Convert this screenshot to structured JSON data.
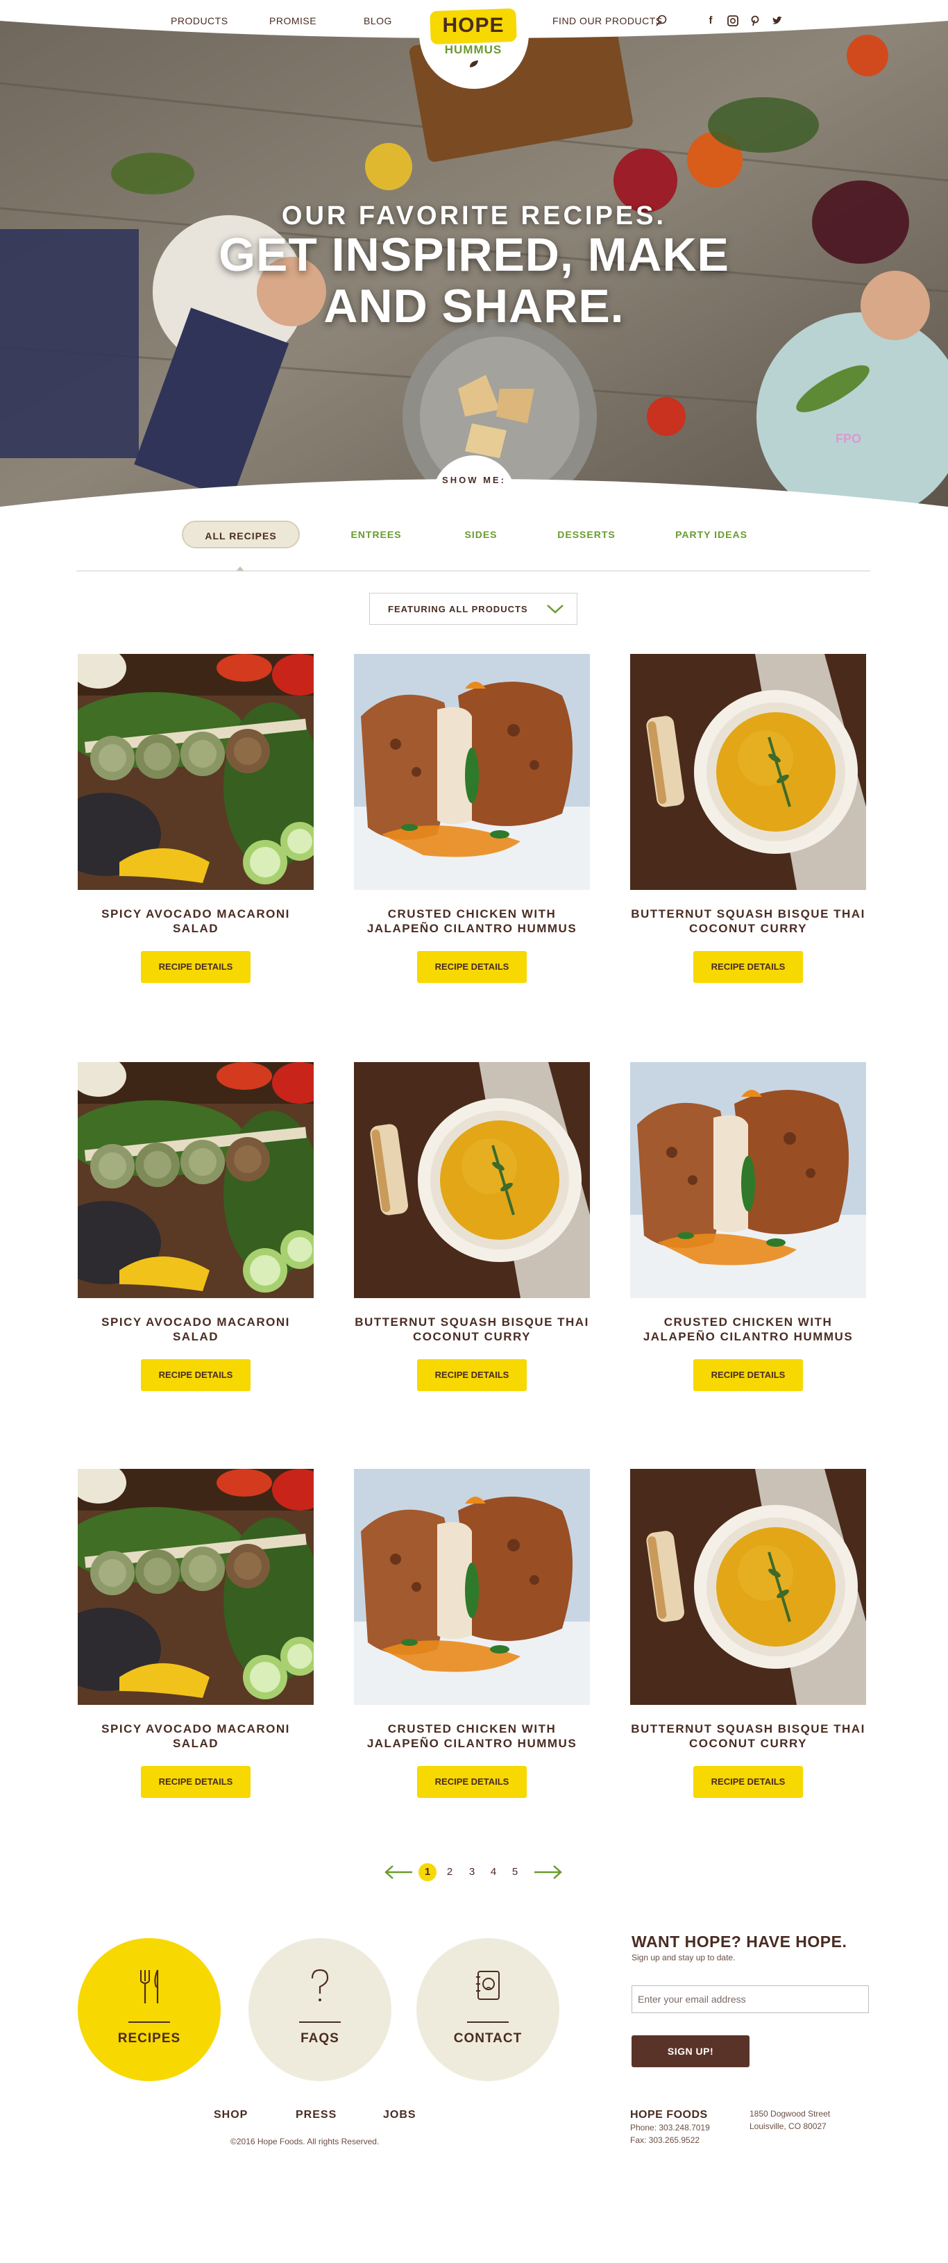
{
  "nav": {
    "products": "PRODUCTS",
    "promise": "PROMISE",
    "blog": "BLOG",
    "find": "FIND OUR PRODUCTS"
  },
  "logo": {
    "brand": "HOPE",
    "sub": "HUMMUS"
  },
  "hero": {
    "kicker": "OUR FAVORITE RECIPES.",
    "title": "GET INSPIRED, MAKE AND SHARE.",
    "fpo": "FPO",
    "show_me": "SHOW ME:"
  },
  "filters": [
    "ALL RECIPES",
    "ENTREES",
    "SIDES",
    "DESSERTS",
    "PARTY IDEAS"
  ],
  "dropdown": {
    "label": "FEATURING ALL PRODUCTS"
  },
  "button_label": "RECIPE DETAILS",
  "recipes": [
    {
      "title": "SPICY AVOCADO MACARONI SALAD",
      "photo": "skewers"
    },
    {
      "title": "CRUSTED CHICKEN WITH JALAPEÑO CILANTRO HUMMUS",
      "photo": "chicken"
    },
    {
      "title": "BUTTERNUT SQUASH BISQUE THAI COCONUT CURRY",
      "photo": "soup"
    },
    {
      "title": "SPICY AVOCADO MACARONI SALAD",
      "photo": "skewers"
    },
    {
      "title": "BUTTERNUT SQUASH BISQUE THAI COCONUT CURRY",
      "photo": "soup"
    },
    {
      "title": "CRUSTED CHICKEN WITH JALAPEÑO CILANTRO HUMMUS",
      "photo": "chicken"
    },
    {
      "title": "SPICY AVOCADO MACARONI SALAD",
      "photo": "skewers"
    },
    {
      "title": "CRUSTED CHICKEN WITH JALAPEÑO CILANTRO HUMMUS",
      "photo": "chicken"
    },
    {
      "title": "BUTTERNUT SQUASH BISQUE THAI COCONUT CURRY",
      "photo": "soup"
    }
  ],
  "pagination": {
    "pages": [
      "1",
      "2",
      "3",
      "4",
      "5"
    ],
    "current": "1"
  },
  "footer": {
    "circles": [
      "RECIPES",
      "FAQS",
      "CONTACT"
    ],
    "newsletter": {
      "title": "WANT HOPE? HAVE HOPE.",
      "text": "Sign up and stay up to date.",
      "placeholder": "Enter your email address",
      "button": "SIGN UP!"
    },
    "links": [
      "SHOP",
      "PRESS",
      "JOBS"
    ],
    "copyright": "©2016 Hope Foods. All rights Reserved.",
    "company": {
      "name": "HOPE FOODS",
      "phone": "Phone: 303.248.7019",
      "fax": "Fax: 303.265.9522",
      "address1": "1850 Dogwood Street",
      "address2": "Louisville, CO 80027"
    }
  },
  "colors": {
    "brand_yellow": "#f7d800",
    "brand_brown": "#4a2c22",
    "brand_green": "#6b9a2e",
    "cream": "#efebdc"
  }
}
